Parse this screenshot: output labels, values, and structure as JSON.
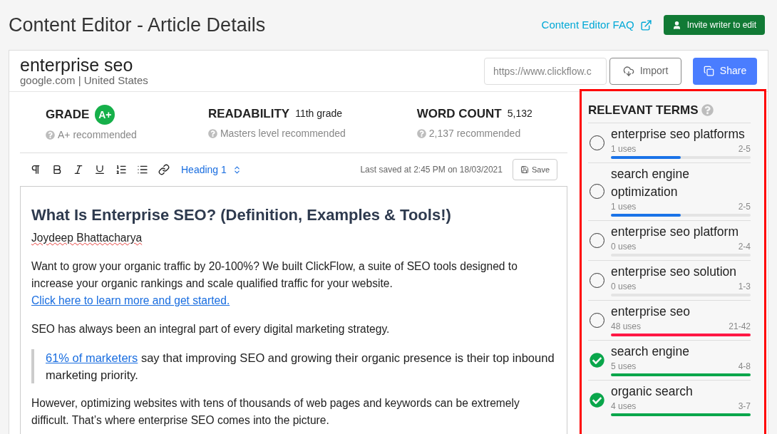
{
  "page_title": "Content Editor - Article Details",
  "header_links": {
    "faq": "Content Editor FAQ",
    "invite": "Invite writer to edit"
  },
  "article": {
    "keyword": "enterprise seo",
    "source": "google.com | United States",
    "url_placeholder": "https://www.clickflow.c",
    "import": "Import",
    "share": "Share"
  },
  "metrics": [
    {
      "label": "GRADE",
      "value": "A+",
      "kind": "badge",
      "hint": "A+ recommended"
    },
    {
      "label": "READABILITY",
      "value": "11th grade",
      "kind": "text",
      "hint": "Masters level recommended"
    },
    {
      "label": "WORD COUNT",
      "value": "5,132",
      "kind": "text",
      "hint": "2,137 recommended"
    }
  ],
  "toolbar": {
    "block_style": "Heading 1",
    "last_saved": "Last saved at 2:45 PM on 18/03/2021",
    "save": "Save"
  },
  "document": {
    "title": "What Is Enterprise SEO? (Definition, Examples & Tools!)",
    "author": {
      "text": "Joydeep Bhattacharya",
      "misspelled": true
    },
    "paragraphs": [
      {
        "kind": "paragraph",
        "parts": [
          {
            "text": "Want to grow your organic traffic by 20-100%? We built ClickFlow, a suite of SEO tools designed to increase your organic rankings and scale qualified traffic for your website. ",
            "kind": "text"
          },
          {
            "text": "Click here to learn more and get started.",
            "kind": "link"
          }
        ]
      },
      {
        "kind": "paragraph",
        "parts": [
          {
            "text": "SEO has always been an integral part of every digital marketing strategy.",
            "kind": "text"
          }
        ]
      },
      {
        "kind": "quote",
        "parts": [
          {
            "text": "61% of marketers",
            "kind": "link"
          },
          {
            "text": " say that improving SEO and growing their organic presence is their top inbound marketing priority.",
            "kind": "text"
          }
        ]
      },
      {
        "kind": "paragraph",
        "parts": [
          {
            "text": "However, optimizing websites with tens of thousands of web pages and keywords can be extremely difficult. That’s where enterprise SEO comes into the picture.",
            "kind": "text"
          }
        ]
      }
    ]
  },
  "relevant_terms": {
    "title": "RELEVANT TERMS",
    "highlighted": true,
    "items": [
      {
        "term": "enterprise seo platforms",
        "uses": "1 uses",
        "range": "2-5",
        "checked": false,
        "level": 0.5,
        "color": "#1a73e8"
      },
      {
        "term": "search engine optimization",
        "uses": "1 uses",
        "range": "2-5",
        "checked": false,
        "level": 0.5,
        "color": "#1a73e8"
      },
      {
        "term": "enterprise seo platform",
        "uses": "0 uses",
        "range": "2-4",
        "checked": false,
        "level": 0
      },
      {
        "term": "enterprise seo solution",
        "uses": "0 uses",
        "range": "1-3",
        "checked": false,
        "level": 0
      },
      {
        "term": "enterprise seo",
        "uses": "48 uses",
        "range": "21-42",
        "checked": false,
        "level": 1,
        "color": "#ff1744"
      },
      {
        "term": "search engine",
        "uses": "5 uses",
        "range": "4-8",
        "checked": true,
        "level": 1,
        "color": "#0aa64b"
      },
      {
        "term": "organic search",
        "uses": "4 uses",
        "range": "3-7",
        "checked": true,
        "level": 1,
        "color": "#0aa64b"
      }
    ]
  }
}
